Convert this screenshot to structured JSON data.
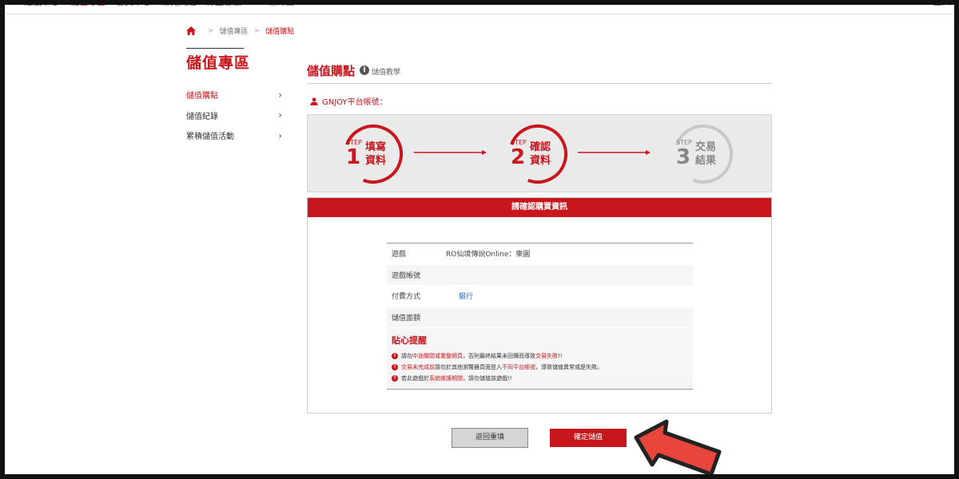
{
  "topnav": {
    "items": [
      "遊戲中心",
      "儲值專區",
      "會員中心",
      "常見問題",
      "線上客服",
      "FB 粉絲團"
    ],
    "right": "登入"
  },
  "breadcrumb": {
    "home_icon": "home-icon",
    "items": [
      "儲值專區",
      "儲值購點"
    ]
  },
  "sidebar": {
    "title": "儲值專區",
    "items": [
      {
        "label": "儲值購點",
        "active": true
      },
      {
        "label": "儲值紀錄",
        "active": false
      },
      {
        "label": "累積儲值活動",
        "active": false
      }
    ]
  },
  "main": {
    "title": "儲值購點",
    "tutorial_label": "儲值教學",
    "account_label": "GNJOY平台帳號："
  },
  "steps": [
    {
      "step_word": "STEP",
      "number": "1",
      "line1": "填寫",
      "line2": "資料",
      "state": "done"
    },
    {
      "step_word": "STEP",
      "number": "2",
      "line1": "確認",
      "line2": "資料",
      "state": "current"
    },
    {
      "step_word": "STEP",
      "number": "3",
      "line1": "交易",
      "line2": "結果",
      "state": "pending"
    }
  ],
  "confirm": {
    "header": "請確認購買資訊",
    "rows": [
      {
        "label": "遊戲",
        "value": "RO仙境傳說Online：樂園"
      },
      {
        "label": "遊戲帳號",
        "value": ""
      },
      {
        "label": "付費方式",
        "value": "銀行"
      },
      {
        "label": "儲值面額",
        "value": ""
      }
    ],
    "notice_title": "貼心提醒",
    "notices": [
      {
        "before": "請勿",
        "highlight": "中途關閉或重整網頁",
        "after": "，否則最終結果未回傳而導致",
        "highlight2": "交易失敗",
        "end": "!!"
      },
      {
        "before": "",
        "highlight": "交易未完成前",
        "after": "請勿於其他瀏覽器頁面登入",
        "highlight2": "不同平台帳號",
        "end": "，導致儲值異常或是失敗。"
      },
      {
        "before": "若此遊戲於",
        "highlight": "系統維護期間",
        "after": "，請勿儲值該遊戲!!",
        "highlight2": "",
        "end": ""
      }
    ]
  },
  "buttons": {
    "back": "返回重填",
    "confirm": "確定儲值"
  },
  "colors": {
    "brand_red": "#c8161d",
    "link_blue": "#2a6ebb",
    "step_inactive": "#bdbdbd"
  }
}
